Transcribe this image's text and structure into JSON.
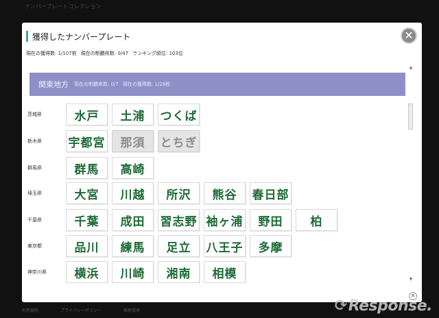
{
  "backdrop": {
    "top_text": "ナンバープレートコレクション",
    "footer_links": [
      "利用規約",
      "プライバシーポリシー",
      "推奨環境"
    ]
  },
  "watermark": "Response.",
  "dialog": {
    "title": "獲得したナンバープレート",
    "stats": {
      "plates": "現在の獲得数: 1/107枚",
      "prefectures": "現在の制覇県数: 0/47",
      "ranking": "ランキング順位: 103位"
    },
    "region": {
      "name": "関東地方",
      "prefs_stat": "現在の制覇県数: 0/7",
      "plates_stat": "現在の獲得数: 1/28枚"
    },
    "prefectures": [
      {
        "name": "茨城県",
        "plates": [
          {
            "label": "水戸",
            "locked": false
          },
          {
            "label": "土浦",
            "locked": false
          },
          {
            "label": "つくば",
            "locked": false
          }
        ]
      },
      {
        "name": "栃木県",
        "plates": [
          {
            "label": "宇都宮",
            "locked": false
          },
          {
            "label": "那須",
            "locked": true
          },
          {
            "label": "とちぎ",
            "locked": true
          }
        ]
      },
      {
        "name": "群馬県",
        "plates": [
          {
            "label": "群馬",
            "locked": false
          },
          {
            "label": "高崎",
            "locked": false
          }
        ]
      },
      {
        "name": "埼玉県",
        "plates": [
          {
            "label": "大宮",
            "locked": false
          },
          {
            "label": "川越",
            "locked": false
          },
          {
            "label": "所沢",
            "locked": false
          },
          {
            "label": "熊谷",
            "locked": false
          },
          {
            "label": "春日部",
            "locked": false
          }
        ]
      },
      {
        "name": "千葉県",
        "plates": [
          {
            "label": "千葉",
            "locked": false
          },
          {
            "label": "成田",
            "locked": false
          },
          {
            "label": "習志野",
            "locked": false
          },
          {
            "label": "袖ヶ浦",
            "locked": false
          },
          {
            "label": "野田",
            "locked": false
          },
          {
            "label": "柏",
            "locked": false
          }
        ]
      },
      {
        "name": "東京都",
        "plates": [
          {
            "label": "品川",
            "locked": false
          },
          {
            "label": "練馬",
            "locked": false
          },
          {
            "label": "足立",
            "locked": false
          },
          {
            "label": "八王子",
            "locked": false
          },
          {
            "label": "多摩",
            "locked": false
          }
        ]
      },
      {
        "name": "神奈川県",
        "plates": [
          {
            "label": "横浜",
            "locked": false
          },
          {
            "label": "川崎",
            "locked": false
          },
          {
            "label": "湘南",
            "locked": false
          },
          {
            "label": "相模",
            "locked": false
          }
        ]
      }
    ]
  },
  "icons": {
    "close": "close-icon",
    "scroll_up": "scroll-up-icon",
    "scroll_down": "scroll-down-icon"
  }
}
